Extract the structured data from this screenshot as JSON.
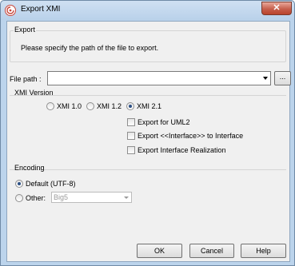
{
  "window": {
    "title": "Export XMI",
    "close_glyph": "✕",
    "app_icon": "visual-paradigm-logo-icon"
  },
  "export_section": {
    "label": "Export",
    "description": "Please specify the path of the file to export."
  },
  "file_path": {
    "label": "File path :",
    "value": "",
    "browse_label": "..."
  },
  "xmi_version": {
    "label": "XMI Version",
    "options": [
      {
        "label": "XMI 1.0",
        "checked": false
      },
      {
        "label": "XMI 1.2",
        "checked": false
      },
      {
        "label": "XMI 2.1",
        "checked": true
      }
    ],
    "checkboxes": [
      {
        "label": "Export for UML2",
        "checked": false
      },
      {
        "label": "Export <<Interface>> to Interface",
        "checked": false
      },
      {
        "label": "Export Interface Realization",
        "checked": false
      }
    ]
  },
  "encoding": {
    "label": "Encoding",
    "default_label": "Default (UTF-8)",
    "default_checked": true,
    "other_label": "Other:",
    "other_checked": false,
    "other_value": "Big5"
  },
  "buttons": {
    "ok": "OK",
    "cancel": "Cancel",
    "help": "Help"
  },
  "colors": {
    "accent": "#2b4f84",
    "titlebar": "#bcd4ec",
    "close": "#c75f4c"
  }
}
